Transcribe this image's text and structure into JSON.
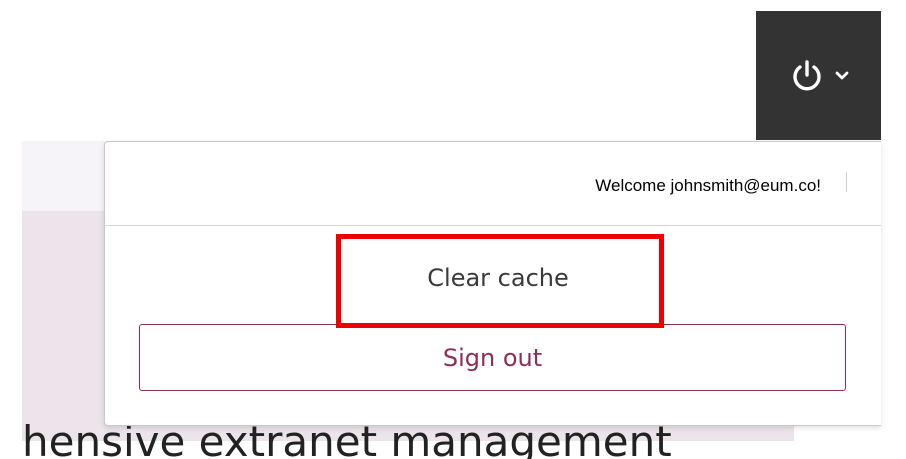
{
  "topbar": {
    "power_icon": "power-icon",
    "chevron_icon": "chevron-down-icon"
  },
  "background": {
    "heading_fragment": "hensive extranet management"
  },
  "dropdown": {
    "welcome": "Welcome johnsmith@eum.co!",
    "clear_cache": "Clear cache",
    "sign_out": "Sign out"
  },
  "colors": {
    "topbar_bg": "#333333",
    "accent": "#8e2d5a",
    "highlight": "#ee0000"
  }
}
